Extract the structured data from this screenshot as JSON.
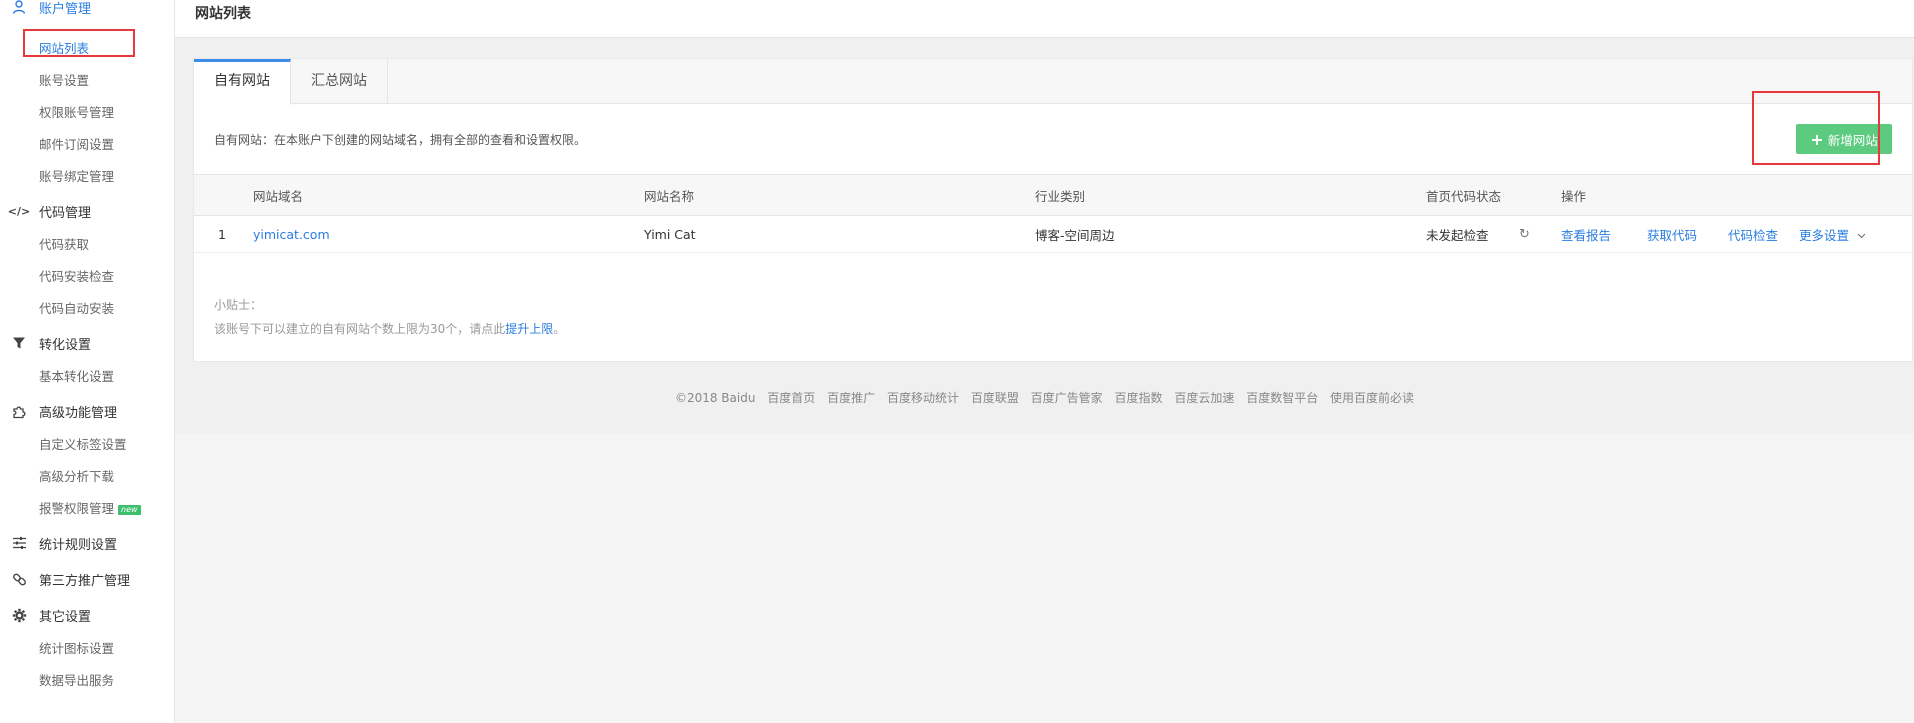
{
  "sidebar": {
    "groups": [
      {
        "label": "账户管理",
        "icon": "user-icon",
        "items": [
          "网站列表",
          "账号设置",
          "权限账号管理",
          "邮件订阅设置",
          "账号绑定管理"
        ]
      },
      {
        "label": "代码管理",
        "icon": "code-icon",
        "items": [
          "代码获取",
          "代码安装检查",
          "代码自动安装"
        ]
      },
      {
        "label": "转化设置",
        "icon": "filter-icon",
        "items": [
          "基本转化设置"
        ]
      },
      {
        "label": "高级功能管理",
        "icon": "puzzle-icon",
        "items": [
          "自定义标签设置",
          "高级分析下载",
          "报警权限管理"
        ]
      },
      {
        "label": "统计规则设置",
        "icon": "sliders-icon",
        "items": []
      },
      {
        "label": "第三方推广管理",
        "icon": "link-icon",
        "items": []
      },
      {
        "label": "其它设置",
        "icon": "gear-icon",
        "items": [
          "统计图标设置",
          "数据导出服务"
        ]
      }
    ],
    "new_badge": "new"
  },
  "header": {
    "title": "网站列表"
  },
  "tabs": [
    "自有网站",
    "汇总网站"
  ],
  "description": "自有网站：在本账户下创建的网站域名，拥有全部的查看和设置权限。",
  "add_button": "新增网站",
  "table": {
    "headers": [
      "网站域名",
      "网站名称",
      "行业类别",
      "首页代码状态",
      "操作"
    ],
    "rows": [
      {
        "index": "1",
        "domain": "yimicat.com",
        "name": "Yimi Cat",
        "category": "博客-空间周边",
        "status": "未发起检查",
        "actions": [
          "查看报告",
          "获取代码",
          "代码检查",
          "更多设置"
        ]
      }
    ]
  },
  "tips": {
    "title": "小贴士：",
    "text": "该账号下可以建立的自有网站个数上限为30个，请点此",
    "link": "提升上限",
    "end": "。"
  },
  "footer": {
    "copyright": "©2018 Baidu",
    "links": [
      "百度首页",
      "百度推广",
      "百度移动统计",
      "百度联盟",
      "百度广告管家",
      "百度指数",
      "百度云加速",
      "百度数智平台",
      "使用百度前必读"
    ]
  },
  "colors": {
    "accent": "#2a7de1",
    "add_button": "#5ccb7f",
    "highlight": "#e5393b"
  }
}
